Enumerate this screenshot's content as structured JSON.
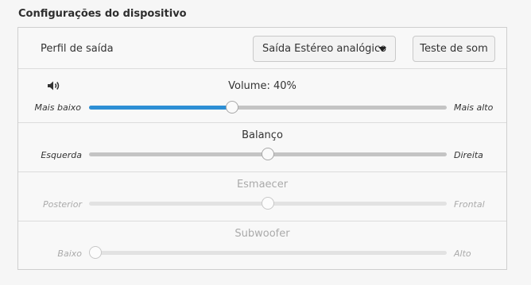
{
  "section_title": "Configurações do dispositivo",
  "profile": {
    "label": "Perfil de saída",
    "dropdown_value": "Saída Estéreo analógico",
    "test_button_label": "Teste de som"
  },
  "volume": {
    "icon": "speaker-volume-icon",
    "title": "Volume: 40%",
    "min_label": "Mais baixo",
    "max_label": "Mais alto",
    "value_fraction": 0.4,
    "fill_color": "#2d8fd5"
  },
  "balance": {
    "title": "Balanço",
    "min_label": "Esquerda",
    "max_label": "Direita",
    "value_fraction": 0.5
  },
  "fade": {
    "title": "Esmaecer",
    "min_label": "Posterior",
    "max_label": "Frontal",
    "value_fraction": 0.5,
    "disabled": true
  },
  "subwoofer": {
    "title": "Subwoofer",
    "min_label": "Baixo",
    "max_label": "Alto",
    "value_fraction": 0.0,
    "disabled": true
  }
}
